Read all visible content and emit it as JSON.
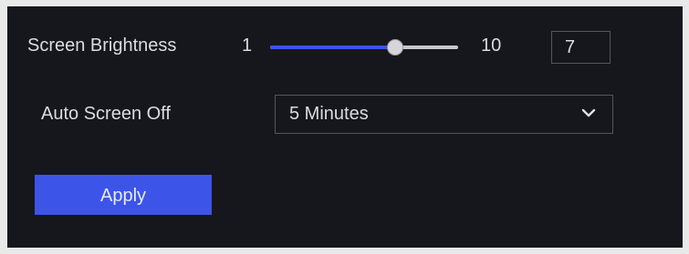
{
  "brightness": {
    "label": "Screen Brightness",
    "min": "1",
    "max": "10",
    "value": "7",
    "slider_fraction": 0.667
  },
  "auto_off": {
    "label": "Auto Screen Off",
    "selected": "5 Minutes"
  },
  "actions": {
    "apply_label": "Apply"
  },
  "colors": {
    "accent": "#3d54e8",
    "panel_bg": "#16161d",
    "text": "#dcdce0"
  }
}
